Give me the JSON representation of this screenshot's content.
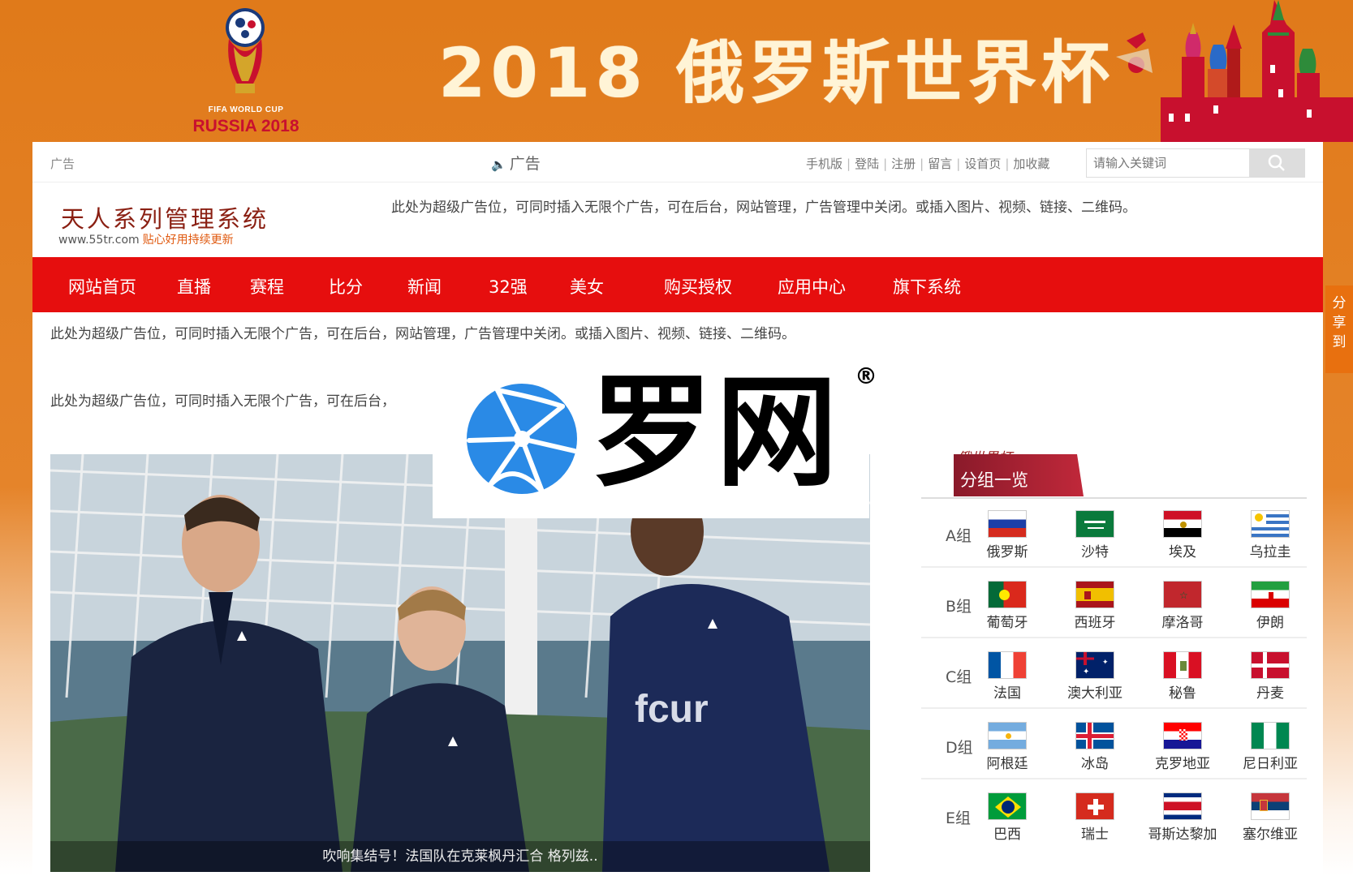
{
  "banner": {
    "title": "2018 俄罗斯世界杯",
    "logo_top": "FIFA WORLD CUP",
    "logo_bottom": "RUSSIA 2018"
  },
  "topbar": {
    "ad_left": "广告",
    "notice": "广告",
    "links": [
      "手机版",
      "登陆",
      "注册",
      "留言",
      "设首页",
      "加收藏"
    ],
    "search_placeholder": "请输入关键词"
  },
  "header": {
    "site_name": "天人系列管理系统",
    "site_url": "www.55tr.com",
    "slogan": "贴心好用持续更新",
    "ad_text": "此处为超级广告位，可同时插入无限个广告，可在后台，网站管理，广告管理中关闭。或插入图片、视频、链接、二维码。"
  },
  "nav": {
    "items": [
      "网站首页",
      "直播",
      "赛程",
      "比分",
      "新闻",
      "32强",
      "美女",
      "购买授权",
      "应用中心",
      "旗下系统"
    ]
  },
  "ads": {
    "line1": "此处为超级广告位，可同时插入无限个广告，可在后台，网站管理，广告管理中关闭。或插入图片、视频、链接、二维码。",
    "line2": "此处为超级广告位，可同时插入无限个广告，可在后台，"
  },
  "photo": {
    "caption": "吹响集结号！法国队在克莱枫丹汇合 格列兹.."
  },
  "watermark": {
    "text": "罗网",
    "reg": "®"
  },
  "groups": {
    "header_script": "俄世界杯",
    "title": "分组一览",
    "rows": [
      {
        "name": "A组",
        "teams": [
          "俄罗斯",
          "沙特",
          "埃及",
          "乌拉圭"
        ]
      },
      {
        "name": "B组",
        "teams": [
          "葡萄牙",
          "西班牙",
          "摩洛哥",
          "伊朗"
        ]
      },
      {
        "name": "C组",
        "teams": [
          "法国",
          "澳大利亚",
          "秘鲁",
          "丹麦"
        ]
      },
      {
        "name": "D组",
        "teams": [
          "阿根廷",
          "冰岛",
          "克罗地亚",
          "尼日利亚"
        ]
      },
      {
        "name": "E组",
        "teams": [
          "巴西",
          "瑞士",
          "哥斯达黎加",
          "塞尔维亚"
        ]
      }
    ]
  },
  "share": {
    "label": "分享到"
  },
  "colors": {
    "banner_orange": "#e07a1a",
    "nav_red": "#e60e0e",
    "tab_red": "#b0243a"
  }
}
